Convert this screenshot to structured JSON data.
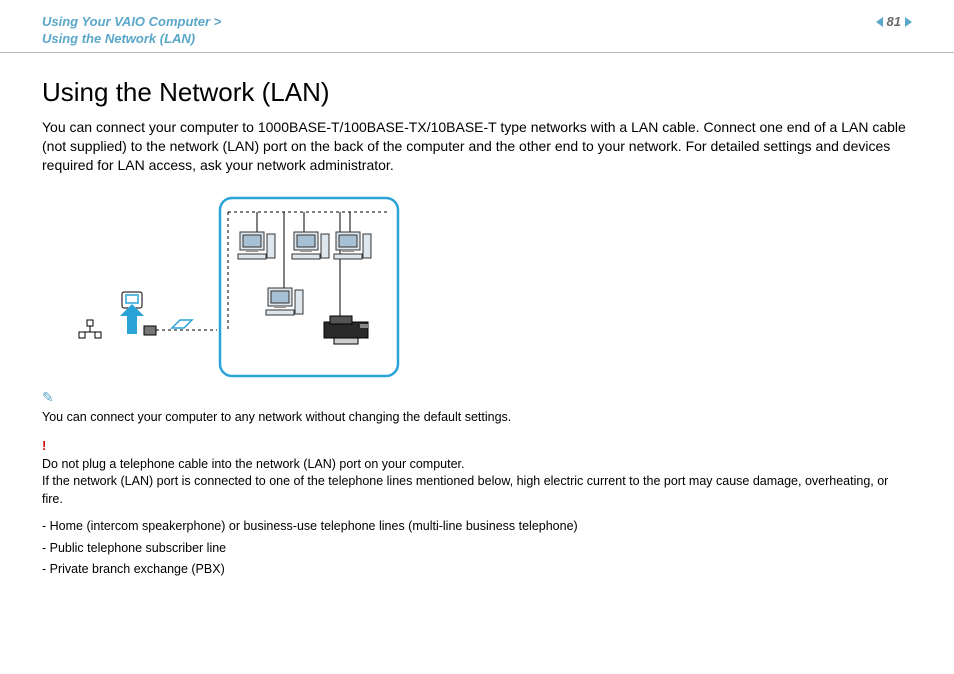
{
  "header": {
    "breadcrumb_line1": "Using Your VAIO Computer >",
    "breadcrumb_line2": "Using the Network (LAN)",
    "page_number": "81"
  },
  "main": {
    "heading": "Using the Network (LAN)",
    "intro": "You can connect your computer to 1000BASE-T/100BASE-TX/10BASE-T type networks with a LAN cable. Connect one end of a LAN cable (not supplied) to the network (LAN) port on the back of the computer and the other end to your network. For detailed settings and devices required for LAN access, ask your network administrator.",
    "note_icon_label": "note-pencil",
    "note_text": "You can connect your computer to any network without changing the default settings.",
    "warning_icon_label": "!",
    "warning_line1": "Do not plug a telephone cable into the network (LAN) port on your computer.",
    "warning_line2": "If the network (LAN) port is connected to one of the telephone lines mentioned below, high electric current to the port may cause damage, overheating, or fire.",
    "bullets": [
      "Home (intercom speakerphone) or business-use telephone lines (multi-line business telephone)",
      "Public telephone subscriber line",
      "Private branch exchange (PBX)"
    ]
  }
}
